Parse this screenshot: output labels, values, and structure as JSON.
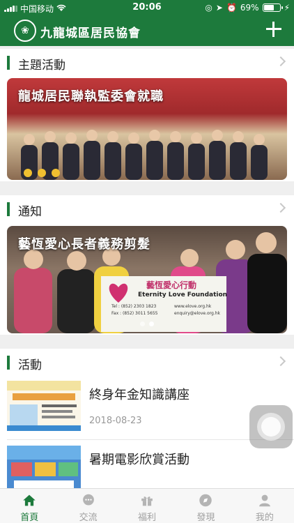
{
  "status_bar": {
    "carrier": "中国移动",
    "time": "20:06",
    "battery": "69%",
    "battery_level": 0.69
  },
  "header": {
    "logo_text": "九龍城區居民協會",
    "title": "九龍城區居民協會"
  },
  "sections": {
    "themes": {
      "title": "主題活動",
      "caption": "龍城居民聯執監委會就職"
    },
    "notices": {
      "title": "通知",
      "caption": "藝恆愛心長者義務剪髮",
      "banner_text": "藝恆愛心行動",
      "banner_sub": "Eternity Love Foundation",
      "tel": "Tel : (852) 2303 1823",
      "fax": "Fax : (852) 3011 5655",
      "web": "www.elove.org.hk",
      "email": "enquiry@elove.org.hk"
    },
    "activities": {
      "title": "活動",
      "items": [
        {
          "title": "終身年金知識講座",
          "date": "2018-08-23"
        },
        {
          "title": "暑期電影欣賞活動",
          "date": ""
        }
      ]
    }
  },
  "tabbar": {
    "items": [
      {
        "label": "首頁",
        "icon": "home-icon"
      },
      {
        "label": "交流",
        "icon": "chat-icon"
      },
      {
        "label": "福利",
        "icon": "gift-icon"
      },
      {
        "label": "發現",
        "icon": "compass-icon"
      },
      {
        "label": "我的",
        "icon": "user-icon"
      }
    ]
  },
  "colors": {
    "brand_green": "#1d7a3c",
    "inactive": "#a0a0a0"
  }
}
